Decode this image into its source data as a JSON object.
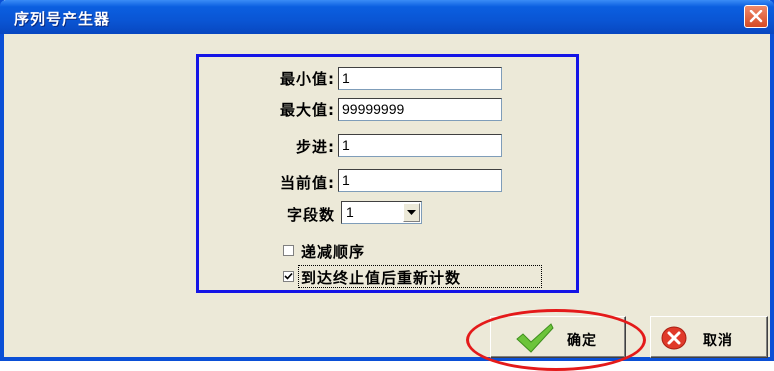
{
  "window": {
    "title": "序列号产生器"
  },
  "form": {
    "min": {
      "label": "最小值:",
      "value": "1"
    },
    "max": {
      "label": "最大值:",
      "value": "99999999"
    },
    "step": {
      "label": "步进:",
      "value": "1"
    },
    "current": {
      "label": "当前值:",
      "value": "1"
    },
    "fields": {
      "label": "字段数",
      "value": "1"
    },
    "decrement": {
      "label": "递减顺序",
      "checked": false
    },
    "restart": {
      "label": "到达终止值后重新计数",
      "checked": true
    }
  },
  "buttons": {
    "ok": "确定",
    "cancel": "取消"
  },
  "colors": {
    "titlebar": "#0a55d4",
    "group_border": "#1414e6",
    "highlight": "#e41a1a",
    "ok_check": "#6cc43a",
    "cancel_icon": "#e03a2a"
  },
  "icons": {
    "close": "close-icon",
    "ok": "check-icon",
    "cancel": "cancel-icon",
    "dropdown": "chevron-down-icon"
  }
}
